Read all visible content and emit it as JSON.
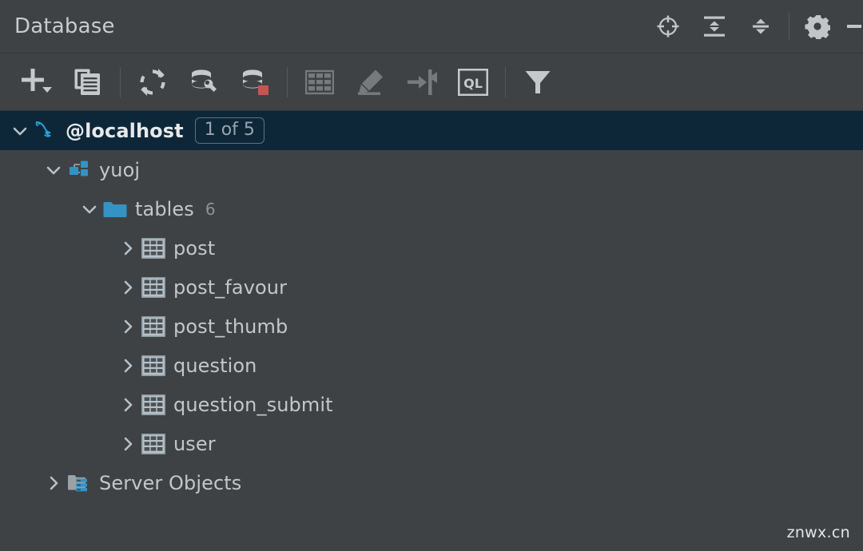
{
  "header": {
    "title": "Database",
    "actions": [
      {
        "name": "locate-icon",
        "label": "Scroll from Source"
      },
      {
        "name": "expand-all-icon",
        "label": "Expand All"
      },
      {
        "name": "collapse-all-icon",
        "label": "Collapse All"
      },
      {
        "name": "gear-icon",
        "label": "Options"
      },
      {
        "name": "minimize-icon",
        "label": "Hide"
      }
    ]
  },
  "toolbar": {
    "buttons": [
      {
        "name": "add-icon",
        "label": "New",
        "enabled": true
      },
      {
        "name": "duplicate-icon",
        "label": "Duplicate",
        "enabled": true
      },
      {
        "name": "refresh-icon",
        "label": "Refresh",
        "enabled": true
      },
      {
        "name": "database-tools-icon",
        "label": "Database Tools",
        "enabled": true
      },
      {
        "name": "database-badge-icon",
        "label": "Data Source Properties",
        "enabled": true
      },
      {
        "name": "table-grid-icon",
        "label": "Open Table Editor",
        "enabled": false
      },
      {
        "name": "edit-pencil-icon",
        "label": "Modify",
        "enabled": false
      },
      {
        "name": "jump-to-icon",
        "label": "Jump to Query Console",
        "enabled": false
      },
      {
        "name": "ql-console-icon",
        "label": "Query Console",
        "enabled": true
      },
      {
        "name": "filter-icon",
        "label": "Filter",
        "enabled": true
      }
    ]
  },
  "tree": {
    "nodes": [
      {
        "name": "data-source-localhost",
        "icon": "mysql-dolphin-icon",
        "label": "@localhost",
        "badge": "1 of 5",
        "expanded": true,
        "selected": true,
        "indent": 0
      },
      {
        "name": "schema-yuoj",
        "icon": "schema-icon",
        "label": "yuoj",
        "expanded": true,
        "selected": false,
        "indent": 1
      },
      {
        "name": "folder-tables",
        "icon": "folder-icon",
        "label": "tables",
        "count": "6",
        "expanded": true,
        "selected": false,
        "indent": 2
      },
      {
        "name": "table-post",
        "icon": "table-icon",
        "label": "post",
        "expanded": false,
        "selected": false,
        "indent": 3
      },
      {
        "name": "table-post-favour",
        "icon": "table-icon",
        "label": "post_favour",
        "expanded": false,
        "selected": false,
        "indent": 3
      },
      {
        "name": "table-post-thumb",
        "icon": "table-icon",
        "label": "post_thumb",
        "expanded": false,
        "selected": false,
        "indent": 3
      },
      {
        "name": "table-question",
        "icon": "table-icon",
        "label": "question",
        "expanded": false,
        "selected": false,
        "indent": 3
      },
      {
        "name": "table-question-submit",
        "icon": "table-icon",
        "label": "question_submit",
        "expanded": false,
        "selected": false,
        "indent": 3
      },
      {
        "name": "table-user",
        "icon": "table-icon",
        "label": "user",
        "expanded": false,
        "selected": false,
        "indent": 3
      },
      {
        "name": "folder-server-objects",
        "icon": "server-objects-icon",
        "label": "Server Objects",
        "expanded": false,
        "selected": false,
        "indent": 1
      }
    ]
  },
  "watermark": {
    "text": "znwx.cn"
  },
  "colors": {
    "panel_bg": "#3f4244",
    "selection_bg": "#0d2739",
    "accent_blue": "#3592c4",
    "badge_red": "#c75450",
    "text": "#c4c7c9",
    "text_dim": "#8e9294"
  }
}
